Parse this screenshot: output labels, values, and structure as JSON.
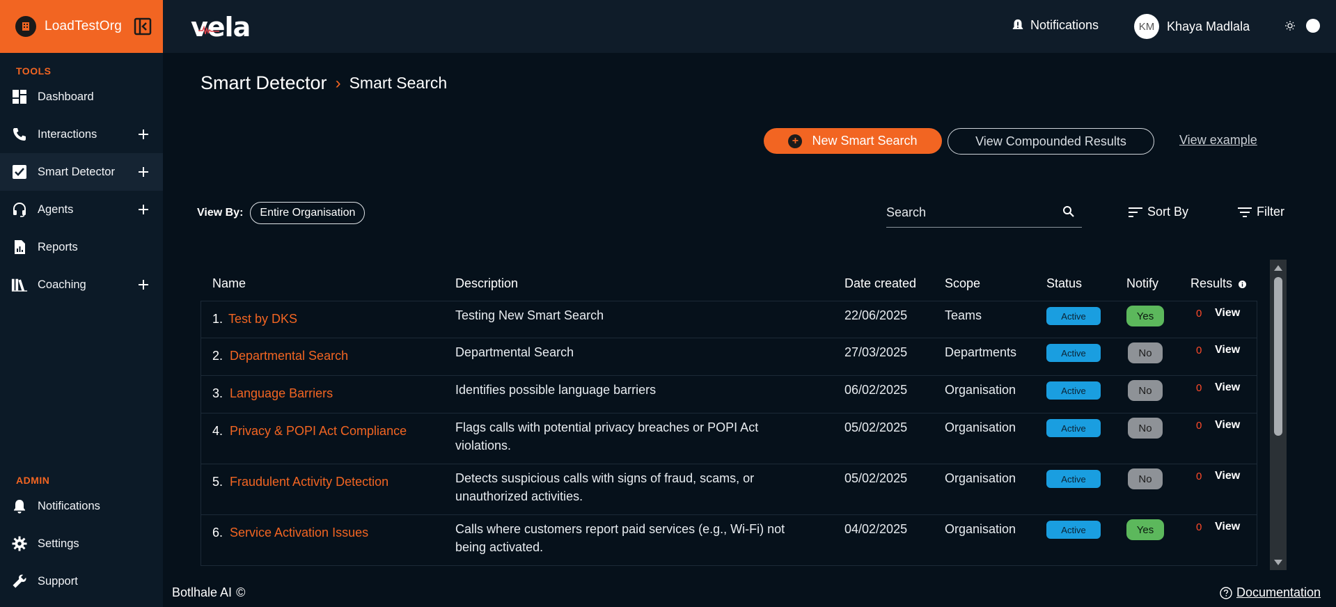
{
  "org": {
    "name": "LoadTestOrg"
  },
  "sidebar": {
    "tools_title": "TOOLS",
    "tools": [
      {
        "label": "Dashboard",
        "icon": "dashboard-icon",
        "has_plus": false
      },
      {
        "label": "Interactions",
        "icon": "phone-icon",
        "has_plus": true
      },
      {
        "label": "Smart Detector",
        "icon": "check-box-icon",
        "has_plus": true,
        "active": true
      },
      {
        "label": "Agents",
        "icon": "headset-icon",
        "has_plus": true
      },
      {
        "label": "Reports",
        "icon": "report-icon",
        "has_plus": false
      },
      {
        "label": "Coaching",
        "icon": "books-icon",
        "has_plus": true
      }
    ],
    "admin_title": "ADMIN",
    "admin": [
      {
        "label": "Notifications",
        "icon": "bell-icon"
      },
      {
        "label": "Settings",
        "icon": "gear-icon"
      },
      {
        "label": "Support",
        "icon": "wrench-icon"
      }
    ]
  },
  "topbar": {
    "brand": "vela",
    "notifications_label": "Notifications",
    "user_initials": "KM",
    "user_name": "Khaya Madlala"
  },
  "breadcrumb": {
    "parent": "Smart Detector",
    "separator": "›",
    "current": "Smart Search"
  },
  "actions": {
    "new_label": "New Smart Search",
    "compound_label": "View Compounded Results",
    "example_label": "View example"
  },
  "view_by": {
    "label": "View By:",
    "value": "Entire Organisation"
  },
  "search": {
    "placeholder": "Search"
  },
  "sort_label": "Sort By",
  "filter_label": "Filter",
  "table": {
    "headers": {
      "name": "Name",
      "description": "Description",
      "date": "Date created",
      "scope": "Scope",
      "status": "Status",
      "notify": "Notify",
      "results": "Results"
    },
    "rows": [
      {
        "num": "1.",
        "name": "Test by DKS",
        "desc1": "Testing New Smart Search",
        "desc2": "",
        "date": "22/06/2025",
        "scope": "Teams",
        "status": "Active",
        "notify": "Yes",
        "count": "0",
        "view": "View"
      },
      {
        "num": "2.",
        "name": "Departmental Search",
        "desc1": "Departmental Search",
        "desc2": "",
        "date": "27/03/2025",
        "scope": "Departments",
        "status": "Active",
        "notify": "No",
        "count": "0",
        "view": "View"
      },
      {
        "num": "3.",
        "name": "Language Barriers",
        "desc1": "Identifies possible language barriers",
        "desc2": "",
        "date": "06/02/2025",
        "scope": "Organisation",
        "status": "Active",
        "notify": "No",
        "count": "0",
        "view": "View"
      },
      {
        "num": "4.",
        "name": "Privacy & POPI Act Compliance",
        "desc1": "Flags calls with potential privacy breaches or POPI Act",
        "desc2": "violations.",
        "date": "05/02/2025",
        "scope": "Organisation",
        "status": "Active",
        "notify": "No",
        "count": "0",
        "view": "View"
      },
      {
        "num": "5.",
        "name": "Fraudulent Activity Detection",
        "desc1": "Detects suspicious calls with signs of fraud, scams, or",
        "desc2": "unauthorized activities.",
        "date": "05/02/2025",
        "scope": "Organisation",
        "status": "Active",
        "notify": "No",
        "count": "0",
        "view": "View"
      },
      {
        "num": "6.",
        "name": "Service Activation Issues",
        "desc1": "Calls where customers report paid services (e.g., Wi-Fi) not",
        "desc2": "being activated.",
        "date": "04/02/2025",
        "scope": "Organisation",
        "status": "Active",
        "notify": "Yes",
        "count": "0",
        "view": "View"
      }
    ]
  },
  "footer": {
    "company": "Botlhale AI",
    "copyright": "©",
    "docs_label": "Documentation"
  },
  "colors": {
    "accent": "#f26522",
    "active_badge": "#1a9ee0",
    "yes_badge": "#5cb85c",
    "no_badge": "#8e9297"
  }
}
